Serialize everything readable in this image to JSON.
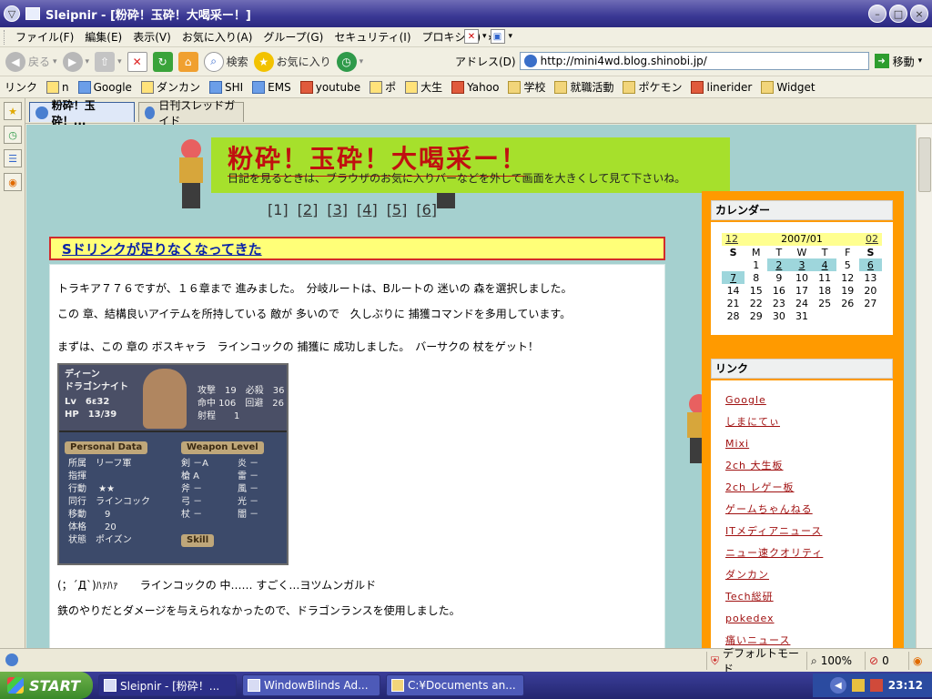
{
  "window": {
    "title": "Sleipnir - [粉砕！玉砕！大喝采ー！]"
  },
  "menu": [
    "ファイル(F)",
    "編集(E)",
    "表示(V)",
    "お気に入り(A)",
    "グループ(G)",
    "セキュリティ(I)",
    "プロキシ(P)"
  ],
  "nav": {
    "back": "戻る",
    "search": "検索",
    "favorites": "お気に入り",
    "address_label": "アドレス(D)",
    "url": "http://mini4wd.blog.shinobi.jp/",
    "go": "移動"
  },
  "links_label": "リンク",
  "links": [
    "n",
    "Google",
    "ダンカン",
    "SHI",
    "EMS",
    "youtube",
    "ポ",
    "大生",
    "Yahoo",
    "学校",
    "就職活動",
    "ポケモン",
    "linerider",
    "Widget"
  ],
  "tabs": [
    "粉砕！玉砕！...",
    "日刊スレッドガイド"
  ],
  "page": {
    "blog_title": "粉砕！玉砕！大喝采ー！",
    "blog_subtitle": "日記を見るときは、ブラウザのお気に入りバーなどを外して画面を大きくして見て下さいね。",
    "pager": [
      "[1]",
      "[2]",
      "[3]",
      "[4]",
      "[5]",
      "[6]"
    ],
    "post_title": "Sドリンクが足りなくなってきた",
    "paragraphs": [
      "トラキア７７６ですが、１６章まで 進みました。　分岐ルートは、Bルートの 迷いの 森を選択しました。",
      "この 章、結構良いアイテムを所持している 敵が 多いので　久しぶりに 捕獲コマンドを多用しています。",
      "まずは、この 章の ボスキャラ　ラインコックの 捕獲に 成功しました。　バーサクの 杖をゲット！",
      "(；´Д`)ﾊｧﾊｧ　　ラインコックの 中…… すごく…ヨツムンガルド",
      "鉄のやりだとダメージを与えられなかったので、ドラゴンランスを使用しました。"
    ],
    "game": {
      "name": "ディーン",
      "class": "ドラゴンナイト",
      "lv": "Lv　6ε32",
      "hp": "HP　13/39",
      "stats": [
        "攻撃　19　必殺　36",
        "命中 106　回避　26",
        "射程　　1"
      ],
      "personal_tag": "Personal Data",
      "weapon_tag": "Weapon Level",
      "skill_tag": "Skill",
      "personal": [
        "所属　リーフ軍",
        "指揮",
        "行動　 ★★",
        "同行　ラインコック",
        "移動　　9",
        "体格　　20",
        "状態　ポイズン"
      ],
      "weapons": [
        "剣 －A",
        "槍 A",
        "斧 －",
        "弓 －",
        "杖 －"
      ],
      "magic": [
        "炎 －",
        "雷 －",
        "風 －",
        "光 －",
        "闇 －"
      ]
    }
  },
  "sidebar": {
    "calendar_title": "カレンダー",
    "cal_prev": "12",
    "cal_month": "2007/01",
    "cal_next": "02",
    "weekdays": [
      "S",
      "M",
      "T",
      "W",
      "T",
      "F",
      "S"
    ],
    "weeks": [
      [
        "",
        "1",
        "2",
        "3",
        "4",
        "5",
        "6"
      ],
      [
        "7",
        "8",
        "9",
        "10",
        "11",
        "12",
        "13"
      ],
      [
        "14",
        "15",
        "16",
        "17",
        "18",
        "19",
        "20"
      ],
      [
        "21",
        "22",
        "23",
        "24",
        "25",
        "26",
        "27"
      ],
      [
        "28",
        "29",
        "30",
        "31",
        "",
        "",
        ""
      ]
    ],
    "highlighted_days": [
      "2",
      "3",
      "4",
      "6",
      "7"
    ],
    "links_title": "リンク",
    "links": [
      "Google",
      "しまにてぃ",
      "Mixi",
      "2ch 大生板",
      "2ch レゲー板",
      "ゲームちゃんねる",
      "ITメディアニュース",
      "ニュー速クオリティ",
      "ダンカン",
      "Tech総研",
      "pokedex",
      "痛いニュース"
    ]
  },
  "status": {
    "mode": "デフォルトモード",
    "zoom": "100%",
    "blocked": "0"
  },
  "taskbar": {
    "start": "START",
    "items": [
      "Sleipnir - [粉砕！...",
      "WindowBlinds Ad...",
      "C:¥Documents an..."
    ],
    "clock": "23:12"
  },
  "colors": {
    "accent": "#ff9a00",
    "header_bg": "#a6e02c",
    "page_bg": "#a5d0cf",
    "title_red": "#c01010"
  }
}
